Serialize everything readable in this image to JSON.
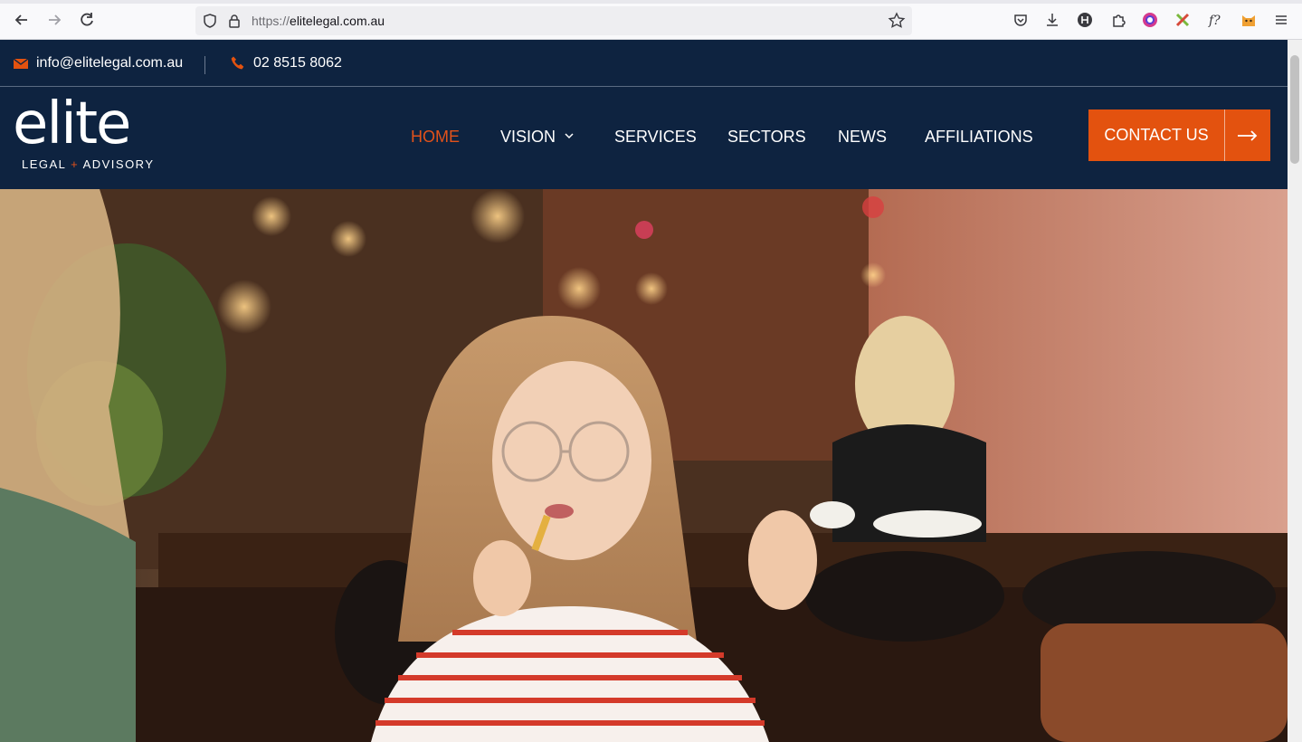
{
  "browser": {
    "url_protocol": "https://",
    "url_domain": "elitelegal.com.au"
  },
  "site": {
    "topbar": {
      "email": "info@elitelegal.com.au",
      "phone": "02 8515 8062"
    },
    "logo": {
      "word": "elite",
      "sub_left": "LEGAL",
      "sub_plus": "+",
      "sub_right": "ADVISORY"
    },
    "nav": {
      "home": "HOME",
      "vision": "VISION",
      "services": "SERVICES",
      "sectors": "SECTORS",
      "news": "NEWS",
      "affiliations": "AFFILIATIONS"
    },
    "cta": {
      "label": "CONTACT US"
    }
  },
  "colors": {
    "navy": "#0e2340",
    "accent": "#e3520f"
  }
}
